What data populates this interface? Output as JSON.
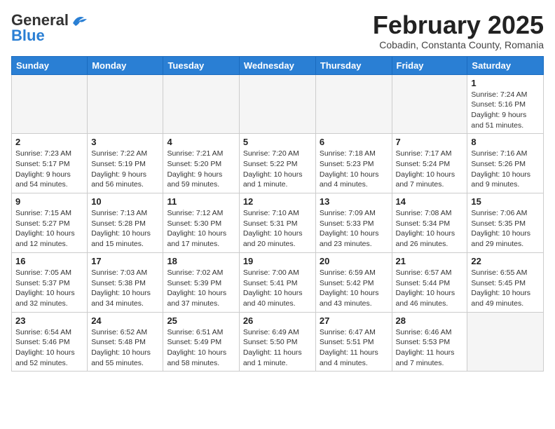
{
  "header": {
    "logo_general": "General",
    "logo_blue": "Blue",
    "month_title": "February 2025",
    "subtitle": "Cobadin, Constanta County, Romania"
  },
  "weekdays": [
    "Sunday",
    "Monday",
    "Tuesday",
    "Wednesday",
    "Thursday",
    "Friday",
    "Saturday"
  ],
  "weeks": [
    [
      {
        "day": "",
        "info": ""
      },
      {
        "day": "",
        "info": ""
      },
      {
        "day": "",
        "info": ""
      },
      {
        "day": "",
        "info": ""
      },
      {
        "day": "",
        "info": ""
      },
      {
        "day": "",
        "info": ""
      },
      {
        "day": "1",
        "info": "Sunrise: 7:24 AM\nSunset: 5:16 PM\nDaylight: 9 hours\nand 51 minutes."
      }
    ],
    [
      {
        "day": "2",
        "info": "Sunrise: 7:23 AM\nSunset: 5:17 PM\nDaylight: 9 hours\nand 54 minutes."
      },
      {
        "day": "3",
        "info": "Sunrise: 7:22 AM\nSunset: 5:19 PM\nDaylight: 9 hours\nand 56 minutes."
      },
      {
        "day": "4",
        "info": "Sunrise: 7:21 AM\nSunset: 5:20 PM\nDaylight: 9 hours\nand 59 minutes."
      },
      {
        "day": "5",
        "info": "Sunrise: 7:20 AM\nSunset: 5:22 PM\nDaylight: 10 hours\nand 1 minute."
      },
      {
        "day": "6",
        "info": "Sunrise: 7:18 AM\nSunset: 5:23 PM\nDaylight: 10 hours\nand 4 minutes."
      },
      {
        "day": "7",
        "info": "Sunrise: 7:17 AM\nSunset: 5:24 PM\nDaylight: 10 hours\nand 7 minutes."
      },
      {
        "day": "8",
        "info": "Sunrise: 7:16 AM\nSunset: 5:26 PM\nDaylight: 10 hours\nand 9 minutes."
      }
    ],
    [
      {
        "day": "9",
        "info": "Sunrise: 7:15 AM\nSunset: 5:27 PM\nDaylight: 10 hours\nand 12 minutes."
      },
      {
        "day": "10",
        "info": "Sunrise: 7:13 AM\nSunset: 5:28 PM\nDaylight: 10 hours\nand 15 minutes."
      },
      {
        "day": "11",
        "info": "Sunrise: 7:12 AM\nSunset: 5:30 PM\nDaylight: 10 hours\nand 17 minutes."
      },
      {
        "day": "12",
        "info": "Sunrise: 7:10 AM\nSunset: 5:31 PM\nDaylight: 10 hours\nand 20 minutes."
      },
      {
        "day": "13",
        "info": "Sunrise: 7:09 AM\nSunset: 5:33 PM\nDaylight: 10 hours\nand 23 minutes."
      },
      {
        "day": "14",
        "info": "Sunrise: 7:08 AM\nSunset: 5:34 PM\nDaylight: 10 hours\nand 26 minutes."
      },
      {
        "day": "15",
        "info": "Sunrise: 7:06 AM\nSunset: 5:35 PM\nDaylight: 10 hours\nand 29 minutes."
      }
    ],
    [
      {
        "day": "16",
        "info": "Sunrise: 7:05 AM\nSunset: 5:37 PM\nDaylight: 10 hours\nand 32 minutes."
      },
      {
        "day": "17",
        "info": "Sunrise: 7:03 AM\nSunset: 5:38 PM\nDaylight: 10 hours\nand 34 minutes."
      },
      {
        "day": "18",
        "info": "Sunrise: 7:02 AM\nSunset: 5:39 PM\nDaylight: 10 hours\nand 37 minutes."
      },
      {
        "day": "19",
        "info": "Sunrise: 7:00 AM\nSunset: 5:41 PM\nDaylight: 10 hours\nand 40 minutes."
      },
      {
        "day": "20",
        "info": "Sunrise: 6:59 AM\nSunset: 5:42 PM\nDaylight: 10 hours\nand 43 minutes."
      },
      {
        "day": "21",
        "info": "Sunrise: 6:57 AM\nSunset: 5:44 PM\nDaylight: 10 hours\nand 46 minutes."
      },
      {
        "day": "22",
        "info": "Sunrise: 6:55 AM\nSunset: 5:45 PM\nDaylight: 10 hours\nand 49 minutes."
      }
    ],
    [
      {
        "day": "23",
        "info": "Sunrise: 6:54 AM\nSunset: 5:46 PM\nDaylight: 10 hours\nand 52 minutes."
      },
      {
        "day": "24",
        "info": "Sunrise: 6:52 AM\nSunset: 5:48 PM\nDaylight: 10 hours\nand 55 minutes."
      },
      {
        "day": "25",
        "info": "Sunrise: 6:51 AM\nSunset: 5:49 PM\nDaylight: 10 hours\nand 58 minutes."
      },
      {
        "day": "26",
        "info": "Sunrise: 6:49 AM\nSunset: 5:50 PM\nDaylight: 11 hours\nand 1 minute."
      },
      {
        "day": "27",
        "info": "Sunrise: 6:47 AM\nSunset: 5:51 PM\nDaylight: 11 hours\nand 4 minutes."
      },
      {
        "day": "28",
        "info": "Sunrise: 6:46 AM\nSunset: 5:53 PM\nDaylight: 11 hours\nand 7 minutes."
      },
      {
        "day": "",
        "info": ""
      }
    ]
  ]
}
